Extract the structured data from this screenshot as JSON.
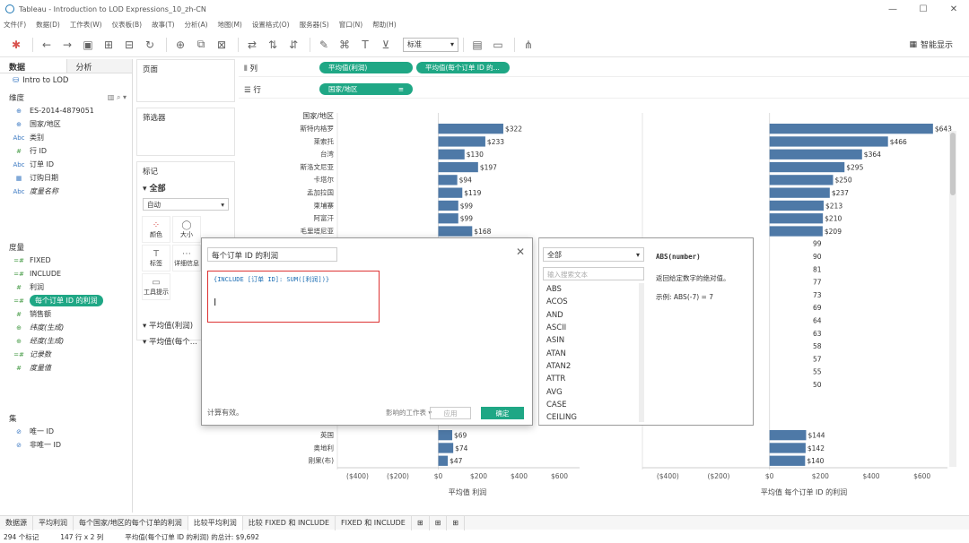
{
  "window": {
    "title": "Tableau - Introduction to LOD Expressions_10_zh-CN",
    "controls": [
      "—",
      "☐",
      "✕"
    ]
  },
  "menu": [
    "文件(F)",
    "数据(D)",
    "工作表(W)",
    "仪表板(B)",
    "故事(T)",
    "分析(A)",
    "地图(M)",
    "设置格式(O)",
    "服务器(S)",
    "窗口(N)",
    "帮助(H)"
  ],
  "toolbar": {
    "fit_select": "标准",
    "show_me": "智能显示"
  },
  "data_pane": {
    "tab_data": "数据",
    "tab_analysis": "分析",
    "datasource": "Intro to LOD",
    "dimensions_label": "维度",
    "dimensions": [
      {
        "type": "⊕",
        "name": "ES-2014-4879051",
        "italic": false
      },
      {
        "type": "⊕",
        "name": "国家/地区",
        "italic": false
      },
      {
        "type": "Abc",
        "name": "类别",
        "italic": false
      },
      {
        "type": "#",
        "name": "行 ID",
        "italic": false
      },
      {
        "type": "Abc",
        "name": "订单 ID",
        "italic": false
      },
      {
        "type": "▦",
        "name": "订购日期",
        "italic": false
      },
      {
        "type": "Abc",
        "name": "度量名称",
        "italic": true
      }
    ],
    "measures_label": "度量",
    "measures": [
      {
        "type": "=#",
        "name": "FIXED",
        "italic": false,
        "selected": false
      },
      {
        "type": "=#",
        "name": "INCLUDE",
        "italic": false,
        "selected": false
      },
      {
        "type": "#",
        "name": "利润",
        "italic": false,
        "selected": false
      },
      {
        "type": "=#",
        "name": "每个订单 ID 的利润",
        "italic": false,
        "selected": true
      },
      {
        "type": "#",
        "name": "销售额",
        "italic": false,
        "selected": false
      },
      {
        "type": "⊕",
        "name": "纬度(生成)",
        "italic": true,
        "selected": false
      },
      {
        "type": "⊕",
        "name": "经度(生成)",
        "italic": true,
        "selected": false
      },
      {
        "type": "=#",
        "name": "记录数",
        "italic": true,
        "selected": false
      },
      {
        "type": "#",
        "name": "度量值",
        "italic": true,
        "selected": false
      }
    ],
    "sets_label": "集",
    "sets": [
      "唯一 ID",
      "非唯一 ID"
    ]
  },
  "shelves": {
    "pages": "页面",
    "filters": "筛选器",
    "marks": "标记",
    "marks_all": "全部",
    "mark_type": "自动",
    "mark_buttons": [
      {
        "icon": "⁘",
        "label": "颜色"
      },
      {
        "icon": "◯",
        "label": "大小"
      },
      {
        "icon": "T",
        "label": "标签"
      },
      {
        "icon": "⋯",
        "label": "详细信息"
      },
      {
        "icon": "▭",
        "label": "工具提示"
      }
    ],
    "mark_cards": [
      "平均值(利润)",
      "平均值(每个..."
    ],
    "columns_label": "列",
    "rows_label": "行",
    "column_pills": [
      "平均值(利润)",
      "平均值(每个订单 ID 的..."
    ],
    "row_pills": [
      "国家/地区"
    ]
  },
  "calc_dialog": {
    "name": "每个订单 ID 的利润",
    "formula": "{INCLUDE [订单 ID]: SUM([利润])}",
    "status": "计算有效。",
    "sheets_affected": "影响的工作表 ▾",
    "apply": "应用",
    "ok": "确定",
    "close": "✕"
  },
  "function_panel": {
    "category": "全部",
    "search_placeholder": "输入搜索文本",
    "functions": [
      "ABS",
      "ACOS",
      "AND",
      "ASCII",
      "ASIN",
      "ATAN",
      "ATAN2",
      "ATTR",
      "AVG",
      "CASE",
      "CEILING"
    ],
    "signature": "ABS(number)",
    "description": "返回给定数字的绝对值。",
    "example": "示例: ABS(-7) = 7"
  },
  "sheet_tabs": [
    "数据源",
    "平均利润",
    "每个国家/地区的每个订单的利润",
    "比较平均利润",
    "比较 FIXED 和 INCLUDE",
    "FIXED 和 INCLUDE"
  ],
  "active_sheet_index": 3,
  "statusbar": {
    "marks": "294 个标记",
    "rows_cols": "147 行 x 2 列",
    "sum": "平均值(每个订单 ID 的利润) 的总计: $9,692"
  },
  "chart_data": {
    "type": "bar",
    "row_header": "国家/地区",
    "categories_top": [
      "斯特内格罗",
      "莱索托",
      "台湾",
      "斯洛文尼亚",
      "卡塔尔",
      "孟加拉国",
      "柬埔寨",
      "阿富汗",
      "毛里塔尼亚"
    ],
    "categories_bottom": [
      "英国",
      "奥地利",
      "刚果(布)"
    ],
    "series": [
      {
        "name": "平均值 利润",
        "values_top": [
          322,
          233,
          130,
          197,
          94,
          119,
          99,
          99,
          168
        ],
        "values_bottom": [
          69,
          74,
          47
        ],
        "labels_top": [
          "$322",
          "$233",
          "$130",
          "$197",
          "$94",
          "$119",
          "$99",
          "$99",
          "$168"
        ],
        "labels_bottom": [
          "$69",
          "$74",
          "$47"
        ],
        "xticks": [
          "($400)",
          "($200)",
          "$0",
          "$200",
          "$400",
          "$600"
        ],
        "xlim": [
          -500,
          700
        ]
      },
      {
        "name": "平均值 每个订单 ID 的利润",
        "values_top": [
          643,
          466,
          364,
          295,
          250,
          237,
          213,
          210,
          209
        ],
        "values_bottom": [
          144,
          142,
          140
        ],
        "labels_top": [
          "$643",
          "$466",
          "$364",
          "$295",
          "$250",
          "$237",
          "$213",
          "$210",
          "$209"
        ],
        "labels_bottom": [
          "$144",
          "$142",
          "$140"
        ],
        "partial_labels_hidden": [
          "99",
          "90",
          "81",
          "77",
          "73",
          "69",
          "64",
          "63",
          "58",
          "57",
          "55",
          "50"
        ],
        "xticks": [
          "($400)",
          "($200)",
          "$0",
          "$200",
          "$400",
          "$600"
        ],
        "xlim": [
          -500,
          700
        ]
      }
    ],
    "bar_color": "#4e79a7"
  }
}
